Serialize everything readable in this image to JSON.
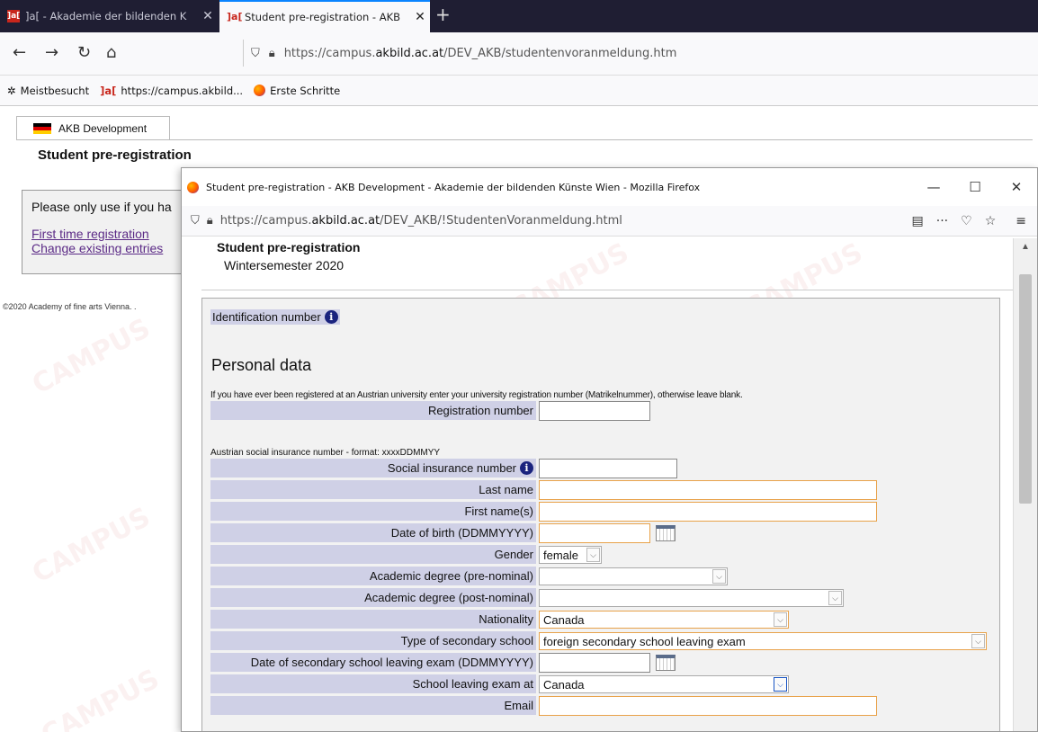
{
  "browser": {
    "tabs": [
      {
        "favicon": "]a[",
        "title": "]a[ - Akademie der bildenden K",
        "close": "✕"
      },
      {
        "favicon": "]a[",
        "title": "Student pre-registration - AKB",
        "close": "✕"
      }
    ],
    "new_tab": "+",
    "url_prefix": "https://campus.",
    "url_domain": "akbild.ac.at",
    "url_path": "/DEV_AKB/studentenvoranmeldung.htm",
    "bookmarks": [
      {
        "icon": "gear-icon",
        "label": "Meistbesucht"
      },
      {
        "icon": "]a[",
        "label": "https://campus.akbild..."
      },
      {
        "icon": "firefox-icon",
        "label": "Erste Schritte"
      }
    ]
  },
  "backpage": {
    "language_tab": "AKB Development",
    "title": "Student pre-registration",
    "notice": "Please only use if you ha",
    "links": [
      "First time registration",
      "Change existing entries"
    ],
    "footer": "©2020 Academy of fine arts Vienna. ."
  },
  "popup": {
    "window_title": "Student pre-registration - AKB Development - Akademie der bildenden Künste Wien - Mozilla Firefox",
    "url_prefix": "https://campus.",
    "url_domain": "akbild.ac.at",
    "url_path": "/DEV_AKB/!StudentenVoranmeldung.html",
    "heading": "Student pre-registration",
    "semester": "Wintersemester 2020",
    "identification_label": "Identification number",
    "section_title": "Personal data",
    "hint_registration": "If you have ever been registered at an Austrian university enter your university registration number (Matrikelnummer), otherwise leave blank.",
    "hint_social": "Austrian social insurance number - format: xxxxDDMMYY",
    "fields": {
      "registration_number": "Registration number",
      "social_insurance": "Social insurance number",
      "last_name": "Last name",
      "first_name": "First name(s)",
      "dob": "Date of birth (DDMMYYYY)",
      "gender": "Gender",
      "gender_value": "female",
      "degree_pre": "Academic degree (pre-nominal)",
      "degree_post": "Academic degree (post-nominal)",
      "nationality": "Nationality",
      "nationality_value": "Canada",
      "school_type": "Type of secondary school",
      "school_type_value": "foreign secondary school leaving exam",
      "exam_date": "Date of secondary school leaving exam (DDMMYYYY)",
      "exam_at": "School leaving exam at",
      "exam_at_value": "Canada",
      "email": "Email"
    }
  }
}
